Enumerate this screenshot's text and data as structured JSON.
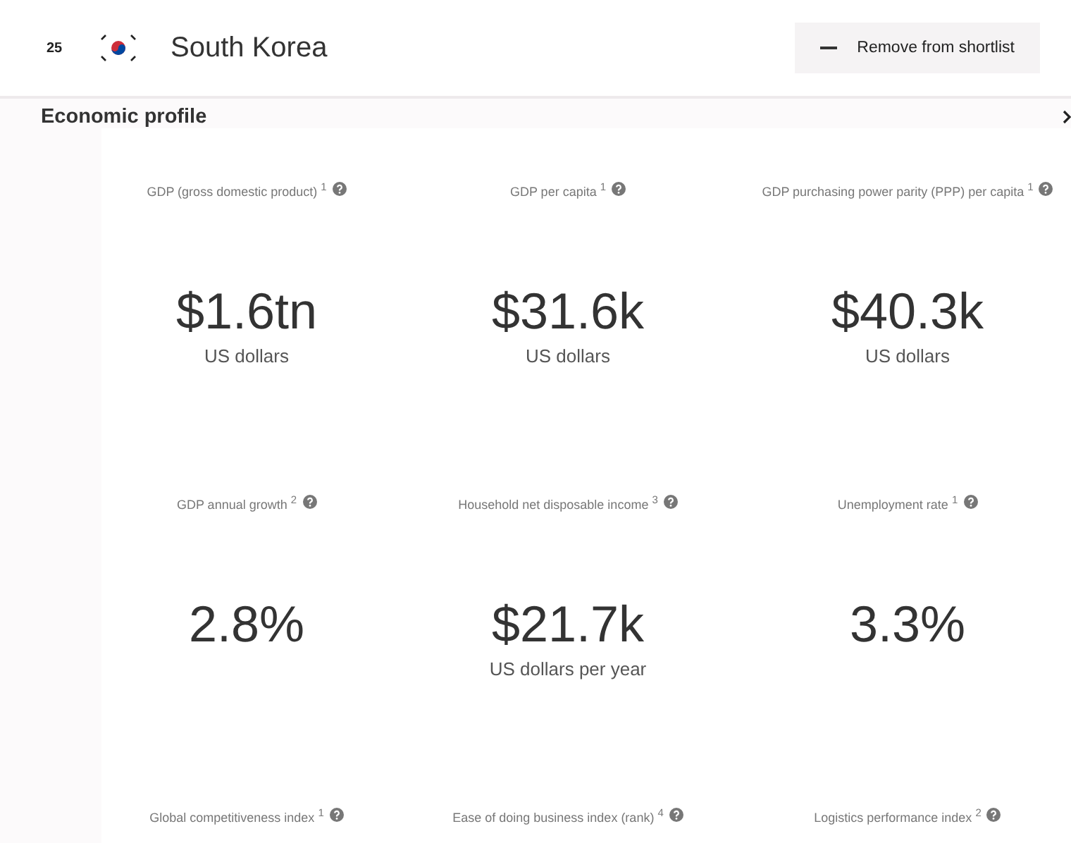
{
  "header": {
    "rank": "25",
    "country": "South Korea",
    "button": "Remove from shortlist"
  },
  "section": {
    "title": "Economic profile"
  },
  "metrics": [
    {
      "label": "GDP (gross domestic product) $^{1}$",
      "value": "$1.6tn",
      "unit": "US dollars"
    },
    {
      "label": "GDP per capita $^{1}$",
      "value": "$31.6k",
      "unit": "US dollars"
    },
    {
      "label": "GDP purchasing power parity (PPP) per capita $^{1}$",
      "value": "$40.3k",
      "unit": "US dollars"
    },
    {
      "label": "GDP annual growth $^{2}$",
      "value": "2.8%"
    },
    {
      "label": "Household net disposable income $^{3}$",
      "value": "$21.7k",
      "unit": "US dollars per year"
    },
    {
      "label": "Unemployment rate $^{1}$",
      "value": "3.3%"
    },
    {
      "label": "Global competitiveness index $^{1}$"
    },
    {
      "label": "Ease of doing business index (rank) $^{4}$"
    },
    {
      "label": "Logistics performance index $^{2}$"
    }
  ]
}
